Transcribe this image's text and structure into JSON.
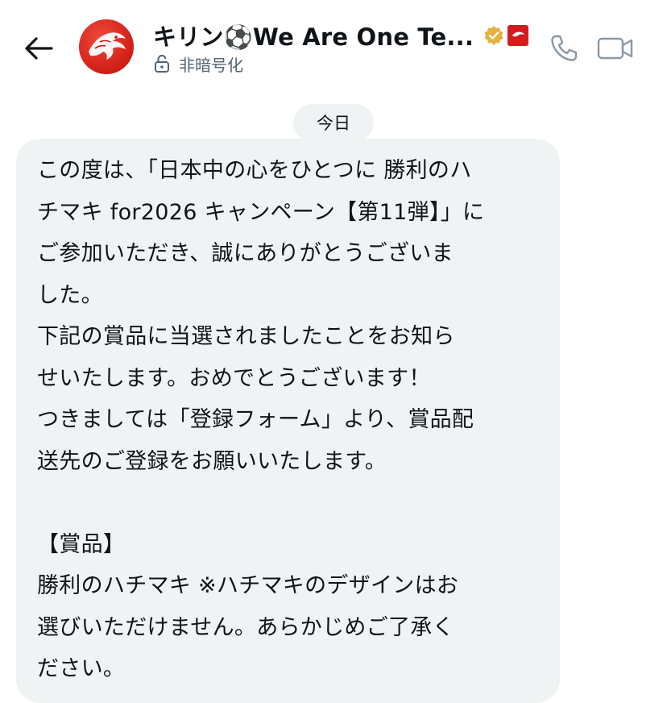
{
  "header": {
    "back_icon": "arrow-left-icon",
    "contact_name": "キリン⚽We Are One Te...",
    "verified_badge_color": "#e3b341",
    "brand_badge_color": "#d31d1d",
    "brand_badge_text": "KIRIN",
    "encryption_status": "非暗号化",
    "call_icon": "phone-icon",
    "video_icon": "video-camera-icon"
  },
  "conversation": {
    "date_label": "今日",
    "messages": [
      {
        "text": "この度は、「日本中の心をひとつに 勝利のハ\nチマキ for2026 キャンペーン【第11弾】」に\nご参加いただき、誠にありがとうございま\nした。\n下記の賞品に当選されましたことをお知ら\nせいたします。おめでとうございます！\nつきましては「登録フォーム」より、賞品配\n送先のご登録をお願いいたします。\n\n【賞品】\n勝利のハチマキ ※ハチマキのデザインはお\n選びいただけません。あらかじめご了承く\nださい。"
      }
    ]
  },
  "colors": {
    "bubble_bg": "#eff3f4",
    "text": "#0f1419",
    "muted": "#536471",
    "icon": "#8b98a5"
  }
}
